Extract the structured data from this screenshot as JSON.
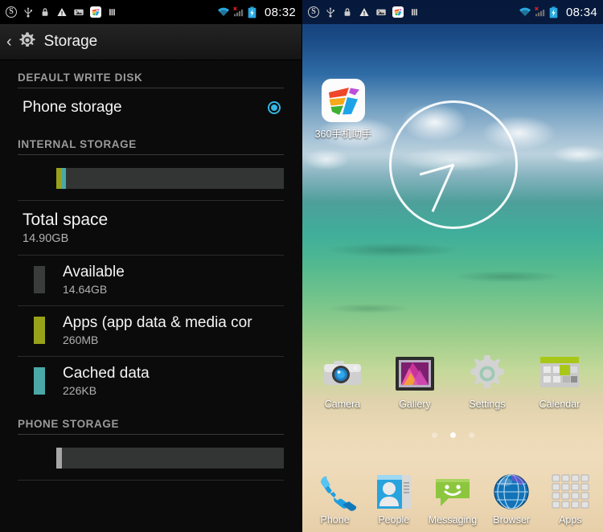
{
  "left_panel": {
    "statusbar": {
      "time": "08:32",
      "icons": [
        "s-circle-icon",
        "usb-icon",
        "lock-icon",
        "warning-triangle-icon",
        "image-icon",
        "360-ball-icon",
        "bars-icon"
      ],
      "right_icons": [
        "wifi-icon",
        "signal-no-service-icon",
        "battery-charging-icon"
      ]
    },
    "actionbar": {
      "back": "‹",
      "icon": "gear-icon",
      "title": "Storage"
    },
    "sections": {
      "default_write_disk": {
        "header": "DEFAULT WRITE DISK",
        "option_label": "Phone storage",
        "selected": true
      },
      "internal_storage": {
        "header": "INTERNAL STORAGE",
        "total_title": "Total space",
        "total_value": "14.90GB",
        "items": [
          {
            "label": "Available",
            "value": "14.64GB",
            "color": "#3a3b3b",
            "bar_percent": 0
          },
          {
            "label": "Apps (app data & media cor",
            "value": "260MB",
            "color": "#97a219",
            "bar_percent": 2.3
          },
          {
            "label": "Cached data",
            "value": "226KB",
            "color": "#4aa8a8",
            "bar_percent": 2.1
          }
        ]
      },
      "phone_storage": {
        "header": "PHONE STORAGE",
        "bar_color": "#a6a6a6",
        "bar_percent": 2.4
      }
    },
    "colors": {
      "accent": "#33b5e5",
      "apps": "#97a219",
      "cached": "#4aa8a8",
      "available": "#3a3b3b"
    }
  },
  "right_panel": {
    "statusbar": {
      "time": "08:34",
      "icons": [
        "s-circle-icon",
        "usb-icon",
        "lock-icon",
        "warning-triangle-icon",
        "image-icon",
        "360-ball-icon",
        "bars-icon"
      ],
      "right_icons": [
        "wifi-icon",
        "signal-no-service-icon",
        "battery-charging-icon"
      ]
    },
    "widget": {
      "name": "analog-clock-widget",
      "hour": 8,
      "minute": 34
    },
    "home_apps": [
      {
        "label": "360手机助手",
        "icon": "360-mobile-assistant-icon"
      },
      {
        "label": "Camera",
        "icon": "camera-icon"
      },
      {
        "label": "Gallery",
        "icon": "gallery-icon"
      },
      {
        "label": "Settings",
        "icon": "settings-gear-icon"
      },
      {
        "label": "Calendar",
        "icon": "calendar-icon"
      }
    ],
    "page_indicator": {
      "pages": 3,
      "current": 2
    },
    "dock": [
      {
        "label": "Phone",
        "icon": "phone-handset-icon"
      },
      {
        "label": "People",
        "icon": "people-contact-icon"
      },
      {
        "label": "Messaging",
        "icon": "messaging-bubble-icon"
      },
      {
        "label": "Browser",
        "icon": "browser-globe-icon"
      },
      {
        "label": "Apps",
        "icon": "apps-grid-icon"
      }
    ]
  }
}
